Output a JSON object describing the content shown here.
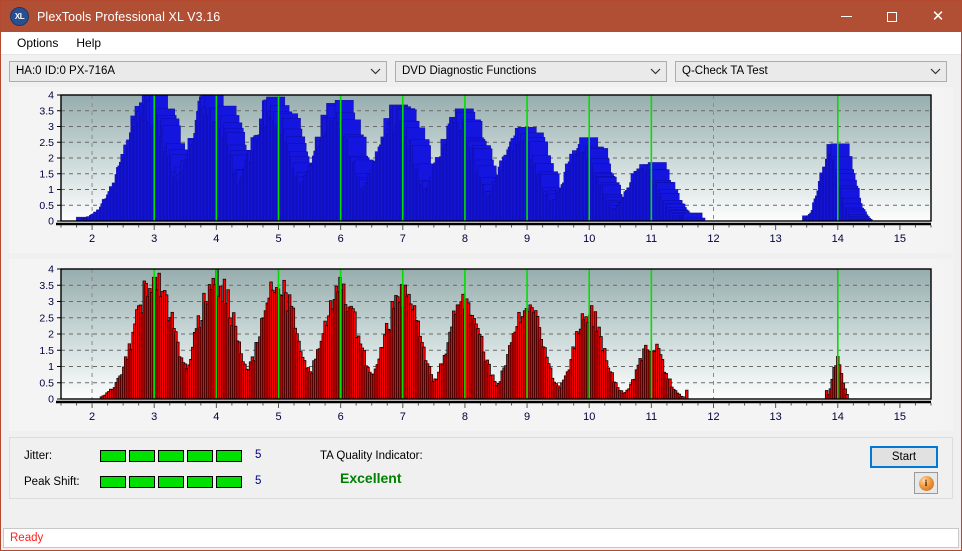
{
  "window": {
    "title": "PlexTools Professional XL V3.16",
    "logo_text": "XL",
    "buttons": {
      "minimize": "minimize-icon",
      "maximize": "maximize-icon",
      "close": "✕"
    }
  },
  "menubar": {
    "items": [
      {
        "label": "Options"
      },
      {
        "label": "Help"
      }
    ]
  },
  "selectors": {
    "drive": "HA:0 ID:0  PX-716A",
    "function_group": "DVD Diagnostic Functions",
    "test": "Q-Check TA Test"
  },
  "bottom_panel": {
    "jitter_label": "Jitter:",
    "jitter_value": "5",
    "jitter_segments": 5,
    "peak_shift_label": "Peak Shift:",
    "peak_shift_value": "5",
    "peak_shift_segments": 5,
    "ta_quality_label": "TA Quality Indicator:",
    "ta_quality_value": "Excellent",
    "start_label": "Start",
    "info_label": "i"
  },
  "statusbar": {
    "text": "Ready"
  },
  "colors": {
    "titlebar": "#b14f35",
    "series_blue": "#1515e0",
    "series_red": "#ff0000",
    "marker_green": "#00e000",
    "meter_green": "#00e000",
    "quality_green": "#008000",
    "status_red": "#ff2020",
    "axis_text": "#000040"
  },
  "chart_data": [
    {
      "id": "jitter-chart",
      "type": "bar",
      "title": "",
      "xlabel": "",
      "ylabel": "",
      "series_color": "#1515e0",
      "bar_style": "solid-filled",
      "grid": true,
      "xlim": [
        1.5,
        15.5
      ],
      "ylim": [
        0,
        4
      ],
      "yticks": [
        0,
        0.5,
        1,
        1.5,
        2,
        2.5,
        3,
        3.5,
        4
      ],
      "ytick_labels": [
        "0",
        "0.5",
        "1",
        "1.5",
        "2",
        "2.5",
        "3",
        "3.5",
        "4"
      ],
      "xticks": [
        2,
        3,
        4,
        5,
        6,
        7,
        8,
        9,
        10,
        11,
        12,
        13,
        14,
        15
      ],
      "xtick_labels": [
        "2",
        "3",
        "4",
        "5",
        "6",
        "7",
        "8",
        "9",
        "10",
        "11",
        "12",
        "13",
        "14",
        "15"
      ],
      "markers": [
        3,
        4,
        5,
        6,
        7,
        8,
        9,
        10,
        11,
        14
      ],
      "marker_color": "#00e000",
      "peaks": [
        {
          "center": 3,
          "height": 3.62,
          "width": 0.62
        },
        {
          "center": 4,
          "height": 3.72,
          "width": 0.58
        },
        {
          "center": 5,
          "height": 3.55,
          "width": 0.55
        },
        {
          "center": 6,
          "height": 3.42,
          "width": 0.55
        },
        {
          "center": 7,
          "height": 3.3,
          "width": 0.55
        },
        {
          "center": 8,
          "height": 3.1,
          "width": 0.55
        },
        {
          "center": 9,
          "height": 2.72,
          "width": 0.52
        },
        {
          "center": 10,
          "height": 2.32,
          "width": 0.48
        },
        {
          "center": 11,
          "height": 1.78,
          "width": 0.42
        },
        {
          "center": 14,
          "height": 2.22,
          "width": 0.26
        }
      ]
    },
    {
      "id": "peak-shift-chart",
      "type": "bar",
      "title": "",
      "xlabel": "",
      "ylabel": "",
      "series_color": "#ff0000",
      "bar_style": "outlined-thin",
      "grid": true,
      "xlim": [
        1.5,
        15.5
      ],
      "ylim": [
        0,
        4
      ],
      "yticks": [
        0,
        0.5,
        1,
        1.5,
        2,
        2.5,
        3,
        3.5,
        4
      ],
      "ytick_labels": [
        "0",
        "0.5",
        "1",
        "1.5",
        "2",
        "2.5",
        "3",
        "3.5",
        "4"
      ],
      "xticks": [
        2,
        3,
        4,
        5,
        6,
        7,
        8,
        9,
        10,
        11,
        12,
        13,
        14,
        15
      ],
      "xtick_labels": [
        "2",
        "3",
        "4",
        "5",
        "6",
        "7",
        "8",
        "9",
        "10",
        "11",
        "12",
        "13",
        "14",
        "15"
      ],
      "markers": [
        3,
        4,
        5,
        6,
        7,
        8,
        9,
        10,
        11,
        14
      ],
      "marker_color": "#00e000",
      "peaks": [
        {
          "center": 3,
          "height": 3.72,
          "width": 0.52
        },
        {
          "center": 4,
          "height": 3.72,
          "width": 0.5
        },
        {
          "center": 5,
          "height": 3.6,
          "width": 0.48
        },
        {
          "center": 6,
          "height": 3.38,
          "width": 0.48
        },
        {
          "center": 7,
          "height": 3.25,
          "width": 0.46
        },
        {
          "center": 8,
          "height": 3.05,
          "width": 0.44
        },
        {
          "center": 9,
          "height": 2.85,
          "width": 0.42
        },
        {
          "center": 10,
          "height": 2.6,
          "width": 0.4
        },
        {
          "center": 11,
          "height": 1.68,
          "width": 0.34
        },
        {
          "center": 14,
          "height": 1.25,
          "width": 0.12
        }
      ]
    }
  ]
}
